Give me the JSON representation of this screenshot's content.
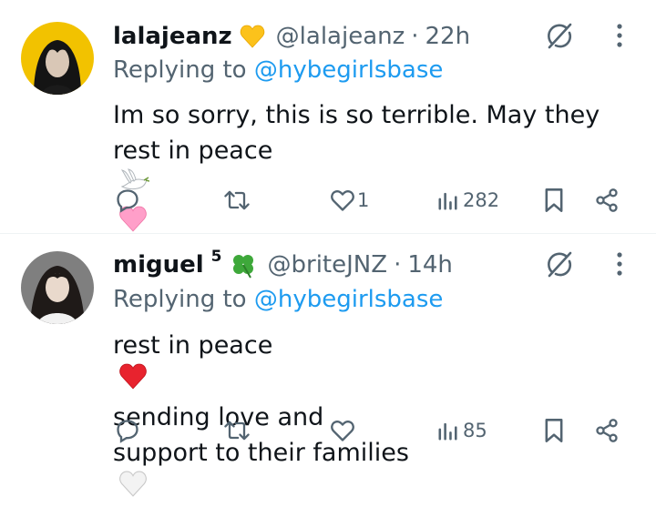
{
  "tweets": [
    {
      "display_name": "lalajeanz",
      "name_emoji": "yellow-heart",
      "handle": "@lalajeanz",
      "separator": "·",
      "time": "22h",
      "replying_prefix": "Replying to",
      "replying_to": "@hybegirlsbase",
      "text_lines": [
        "Im so sorry, this is so terrible. May they",
        "rest in peace"
      ],
      "text_emojis": [
        "dove-emoji",
        "pink-heart-emoji"
      ],
      "replies": "",
      "retweets": "",
      "likes": "1",
      "views": "282"
    },
    {
      "display_name": "miguel",
      "name_superscript": "5",
      "name_emoji": "four-leaf-clover",
      "handle": "@briteJNZ",
      "separator": "·",
      "time": "14h",
      "replying_prefix": "Replying to",
      "replying_to": "@hybegirlsbase",
      "text_lines_1a": "rest in peace",
      "text_lines_1b": "sending love and",
      "text_lines_2": "support to their families",
      "text_emojis": [
        "red-heart-emoji",
        "white-heart-emoji"
      ],
      "replies": "",
      "retweets": "",
      "likes": "",
      "views": "85"
    }
  ],
  "colors": {
    "text": "#0f1419",
    "secondary": "#536471",
    "link": "#1d9bf0",
    "divider": "#eff3f4"
  }
}
